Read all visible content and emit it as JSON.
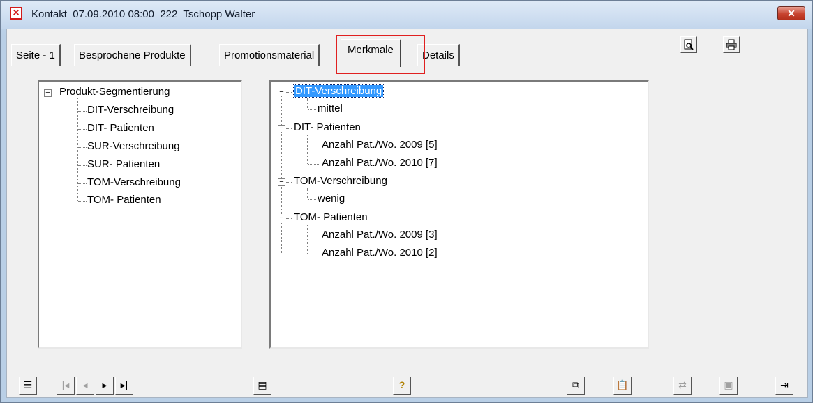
{
  "window": {
    "title": "Kontakt  07.09.2010 08:00  222  Tschopp Walter",
    "close_label": "✕"
  },
  "tabs": [
    {
      "label": "Seite - 1",
      "active": false
    },
    {
      "label": "Besprochene Produkte",
      "active": false
    },
    {
      "label": "Promotionsmaterial",
      "active": false
    },
    {
      "label": "Merkmale",
      "active": true
    },
    {
      "label": "Details",
      "active": false
    }
  ],
  "toolbar": {
    "preview_icon": "print-preview-icon",
    "print_icon": "printer-icon"
  },
  "left_tree": {
    "root": "Produkt-Segmentierung",
    "items": [
      "DIT-Verschreibung",
      "DIT- Patienten",
      "SUR-Verschreibung",
      "SUR- Patienten",
      "TOM-Verschreibung",
      "TOM- Patienten"
    ]
  },
  "right_tree": {
    "groups": [
      {
        "label": "DIT-Verschreibung",
        "selected": true,
        "children": [
          "mittel"
        ]
      },
      {
        "label": "DIT- Patienten",
        "selected": false,
        "children": [
          "Anzahl Pat./Wo. 2009 [5]",
          "Anzahl Pat./Wo. 2010 [7]"
        ]
      },
      {
        "label": "TOM-Verschreibung",
        "selected": false,
        "children": [
          "wenig"
        ]
      },
      {
        "label": "TOM- Patienten",
        "selected": false,
        "children": [
          "Anzahl Pat./Wo. 2009 [3]",
          "Anzahl Pat./Wo. 2010 [2]"
        ]
      }
    ]
  },
  "bottom_bar": {
    "icons": [
      "list-icon",
      "first-record-icon",
      "previous-record-icon",
      "next-record-icon",
      "last-record-icon",
      "properties-icon",
      "help-icon",
      "copy-icon",
      "paste-icon",
      "transfer-icon",
      "save-icon",
      "exit-icon"
    ]
  },
  "colors": {
    "selection": "#3399ff",
    "highlight_box": "#e02020"
  }
}
